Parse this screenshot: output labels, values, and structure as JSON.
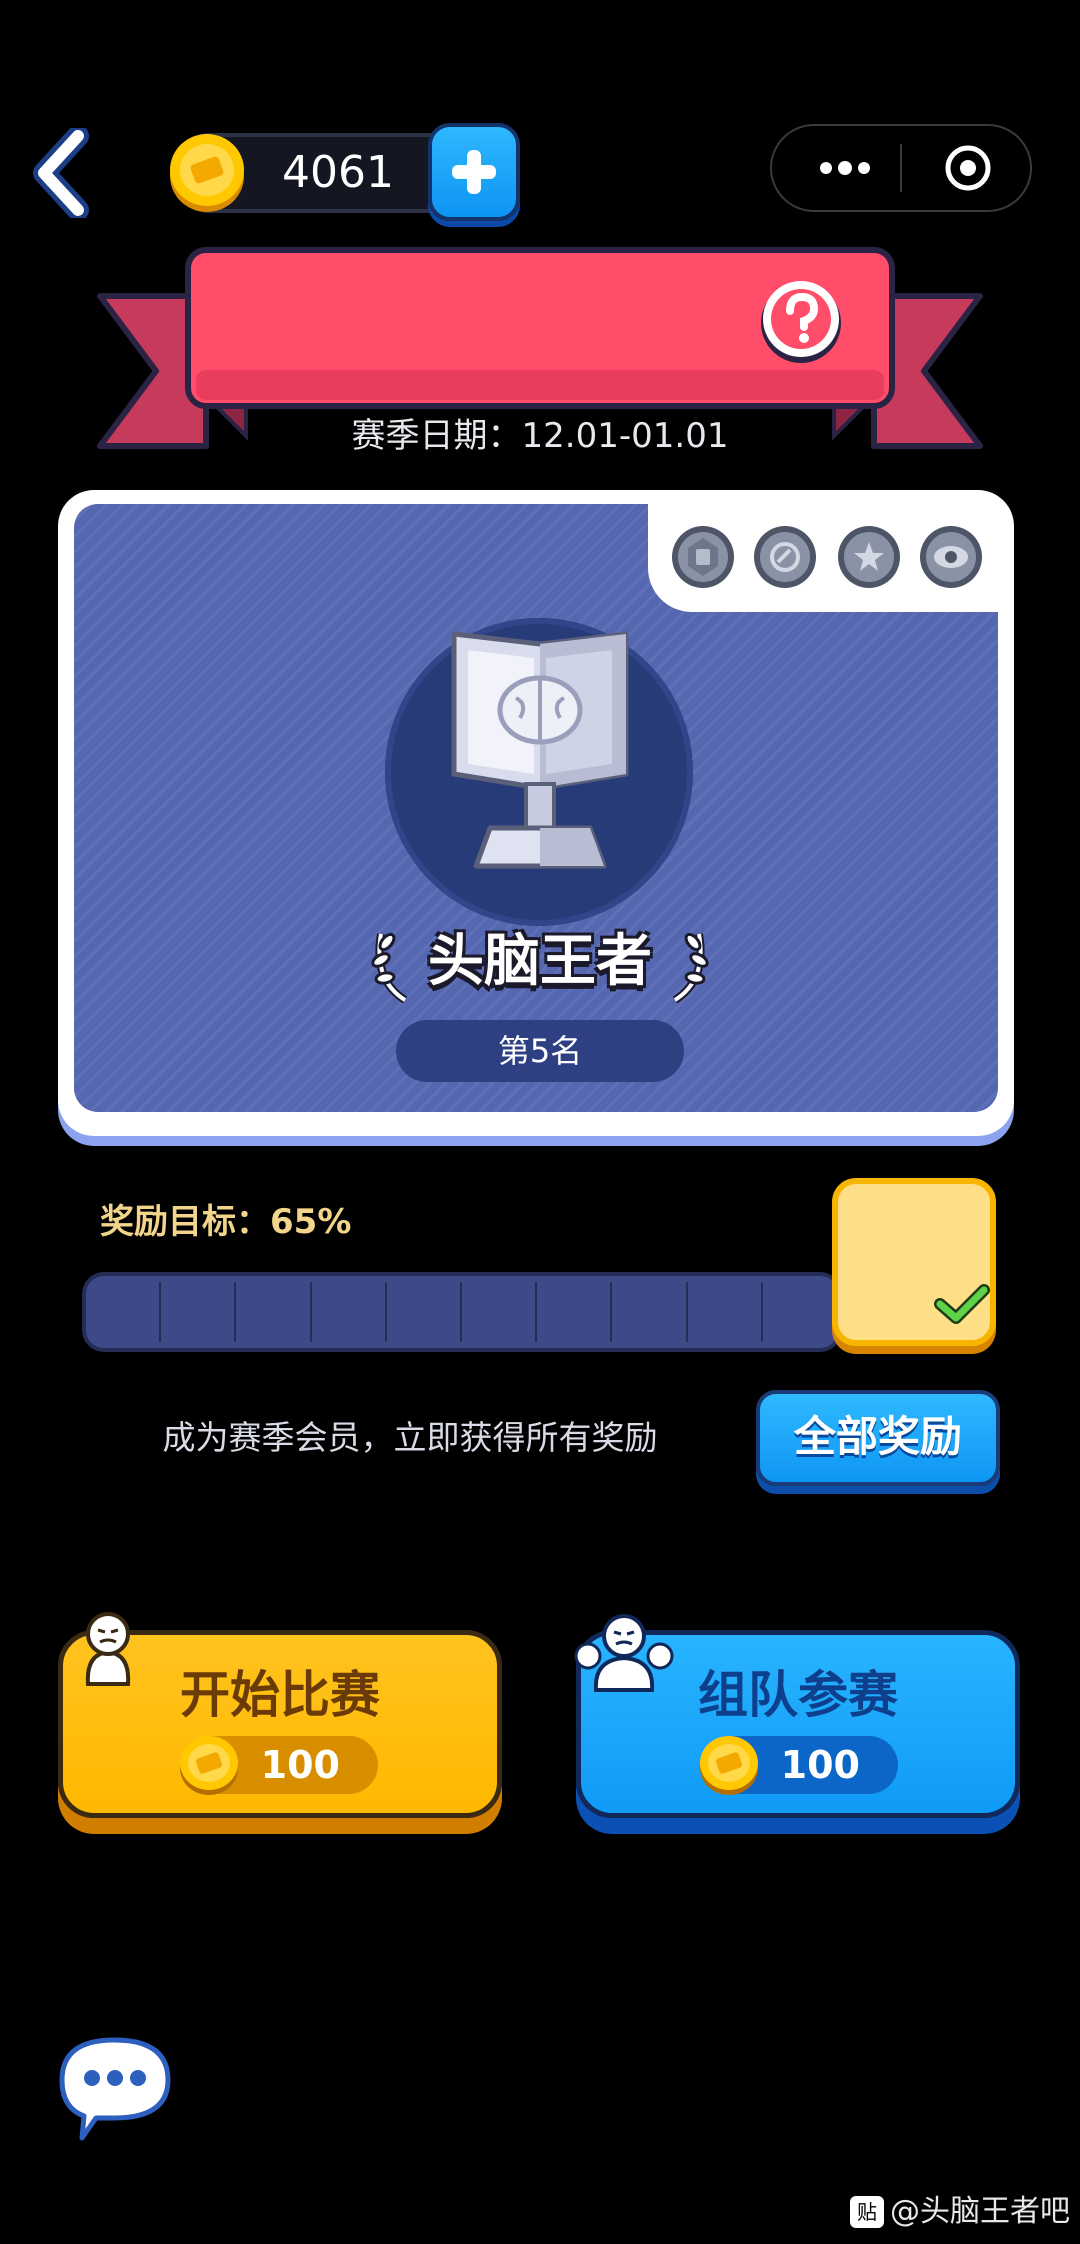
{
  "topbar": {
    "coin_balance": "4061",
    "back_icon": "chevron-left-icon",
    "coin_icon": "gold-coin-icon",
    "add_coins_icon": "plus-icon",
    "more_icon": "more-dots-icon",
    "close_icon": "target-circle-icon"
  },
  "season": {
    "date_text": "赛季日期：12.01-01.01",
    "help_icon": "question-mark-icon"
  },
  "rank_card": {
    "badges": [
      "rank-badge-1-icon",
      "rank-badge-2-icon",
      "rank-badge-3-icon",
      "rank-badge-4-icon"
    ],
    "trophy_icon": "brain-book-trophy-icon",
    "rank_title": "头脑王者",
    "rank_position": "第5名"
  },
  "reward": {
    "target_label": "奖励目标：65%",
    "progress_fraction": 0,
    "segments": 10,
    "reward_box_claimed": true
  },
  "vip": {
    "promo_text": "成为赛季会员，立即获得所有奖励",
    "all_rewards_label": "全部奖励"
  },
  "actions": {
    "start_label": "开始比赛",
    "start_cost": "100",
    "team_label": "组队参赛",
    "team_cost": "100"
  },
  "chat": {
    "icon": "chat-bubble-icon"
  },
  "watermark": {
    "icon_text": "贴",
    "text": "@头脑王者吧"
  },
  "colors": {
    "accent_blue": "#13a0f5",
    "accent_yellow": "#ffbb00",
    "ribbon_red": "#ff4d6a",
    "card_blue": "#5667b2"
  }
}
